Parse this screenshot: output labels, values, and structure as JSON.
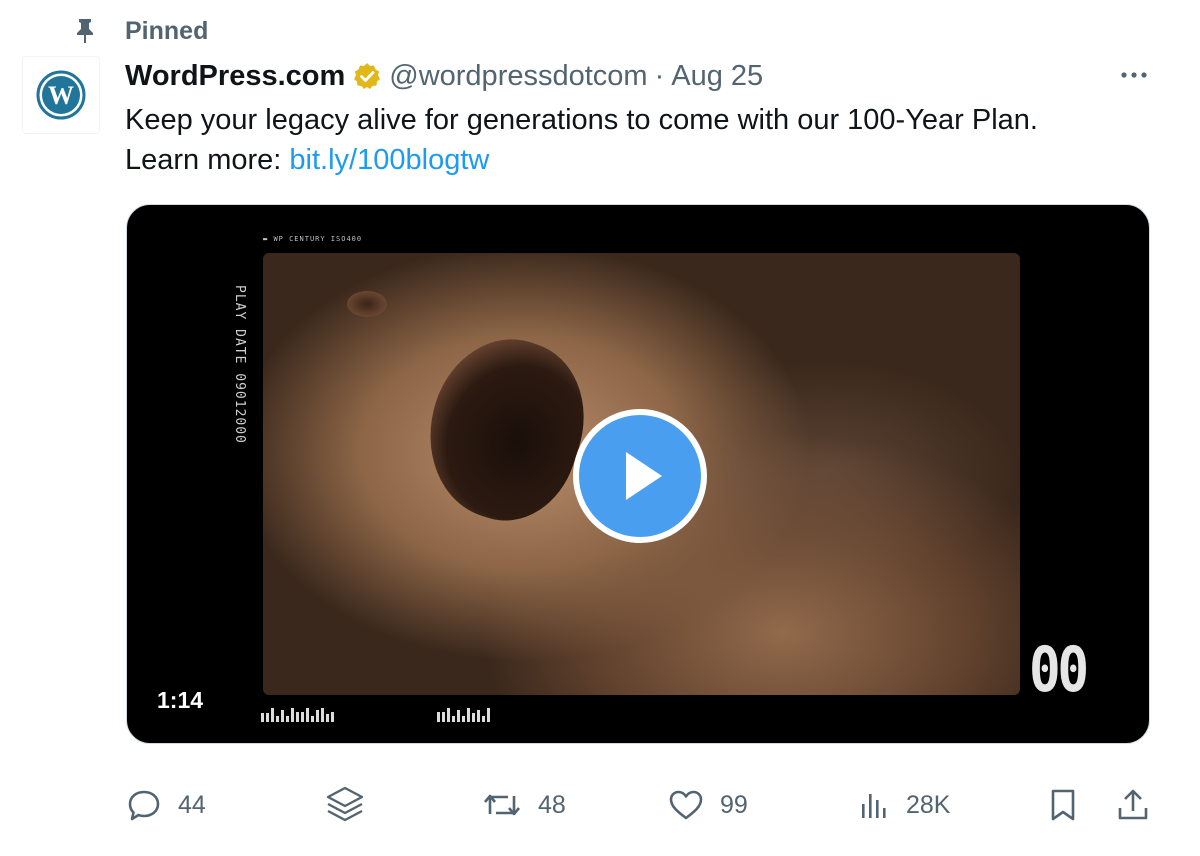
{
  "pinned": {
    "label": "Pinned",
    "icon": "pin-icon"
  },
  "author": {
    "name": "WordPress.com",
    "handle": "@wordpressdotcom",
    "separator": "·",
    "date": "Aug 25",
    "verified_badge": "gold-verified-badge",
    "avatar_icon": "wordpress-logo-icon"
  },
  "tweet": {
    "text_line1": "Keep your legacy alive for generations to come with our 100-Year Plan.",
    "learn_more_prefix": "Learn more: ",
    "link_text": "bit.ly/100blogtw"
  },
  "video": {
    "duration": "1:14",
    "film_top_label": "WP CENTURY ISO400",
    "film_side_label": "PLAY DATE 09012000",
    "frame_counter": "00"
  },
  "actions": {
    "replies": "44",
    "retweets": "48",
    "likes": "99",
    "views": "28K"
  },
  "colors": {
    "link": "#1d9bf0",
    "muted": "#536471",
    "play_button": "#4a9ef0",
    "badge_gold": "#e2b719",
    "wordpress_blue": "#21759b"
  }
}
